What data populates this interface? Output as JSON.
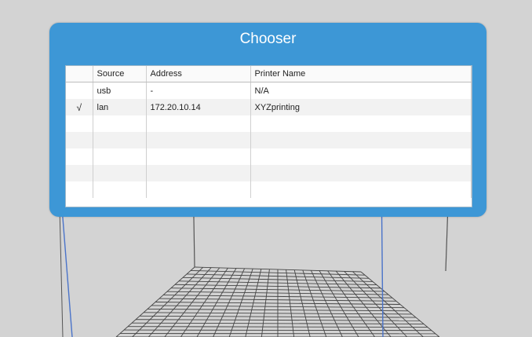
{
  "dialog": {
    "title": "Chooser",
    "columns": [
      "",
      "Source",
      "Address",
      "Printer Name"
    ],
    "rows": [
      {
        "check": "",
        "source": "usb",
        "address": "-",
        "printer": "N/A"
      },
      {
        "check": "√",
        "source": "lan",
        "address": "172.20.10.14",
        "printer": "XYZprinting"
      },
      {
        "check": "",
        "source": "",
        "address": "",
        "printer": ""
      },
      {
        "check": "",
        "source": "",
        "address": "",
        "printer": ""
      },
      {
        "check": "",
        "source": "",
        "address": "",
        "printer": ""
      },
      {
        "check": "",
        "source": "",
        "address": "",
        "printer": ""
      },
      {
        "check": "",
        "source": "",
        "address": "",
        "printer": ""
      }
    ]
  },
  "colors": {
    "background": "#d3d3d3",
    "dialog": "#3d97d6",
    "frame_line": "#555555",
    "frame_line_blue": "#4a73c9",
    "grid": "#444444"
  }
}
